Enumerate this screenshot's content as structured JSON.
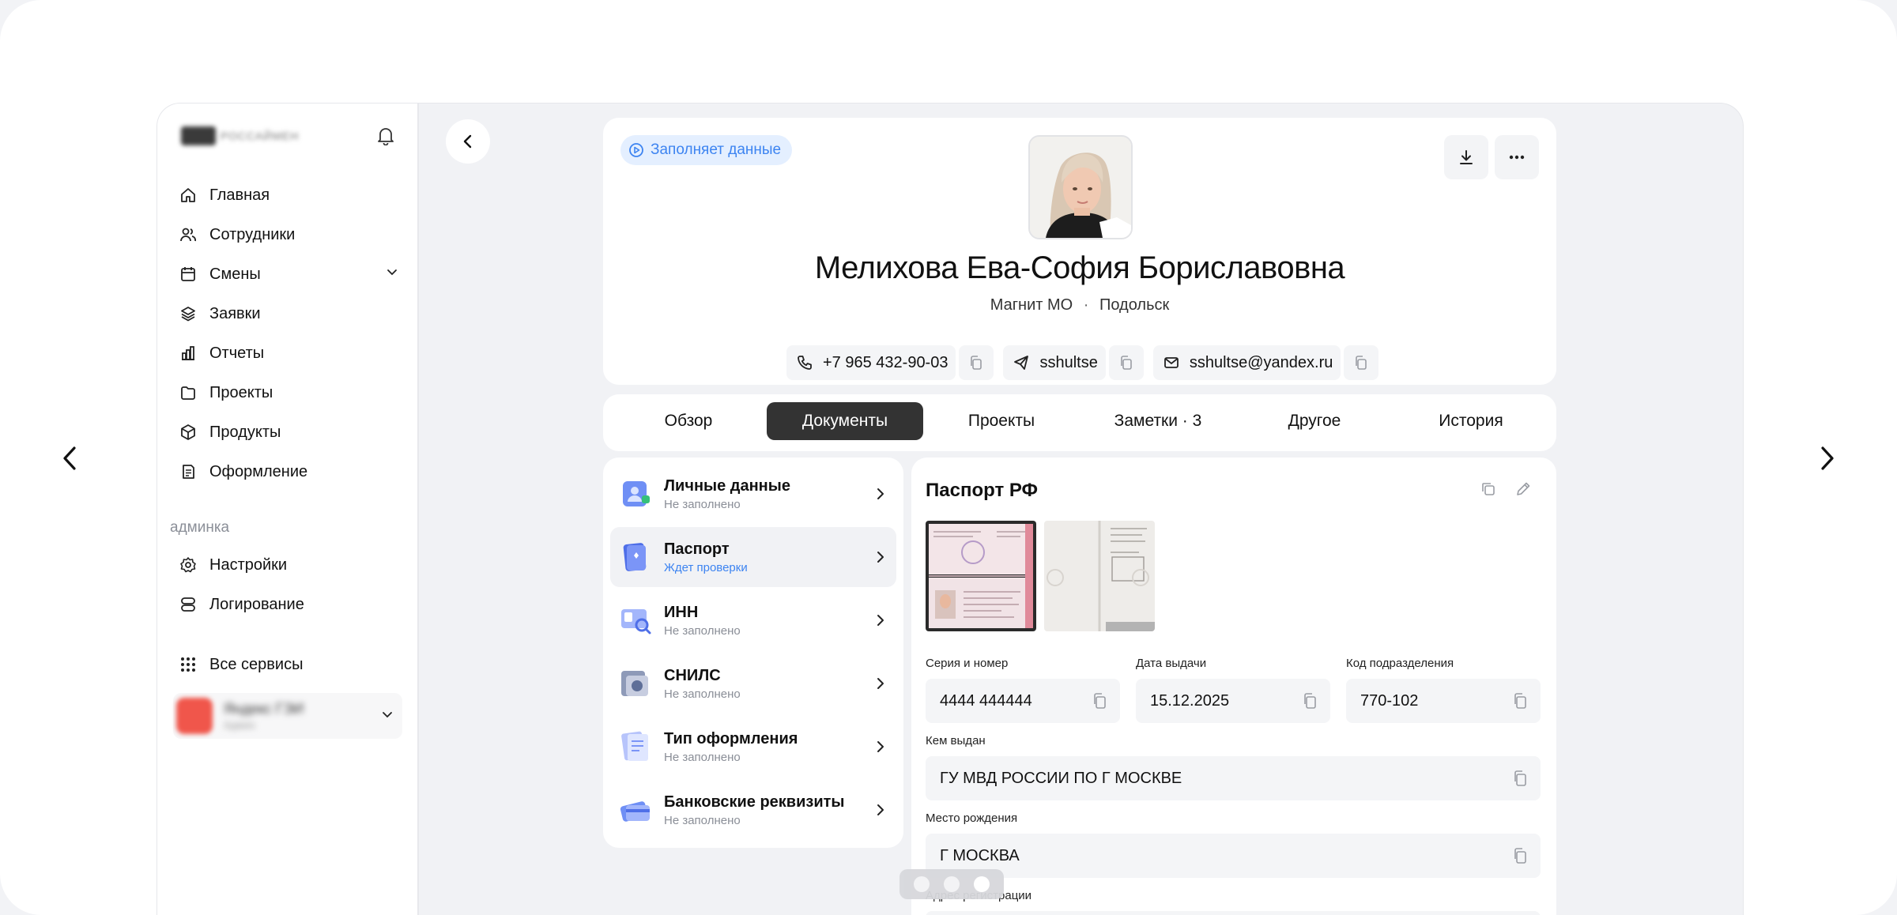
{
  "sidebar": {
    "brand": "РОССАЙМЕН",
    "menu": [
      {
        "label": "Главная",
        "icon": "home-icon"
      },
      {
        "label": "Сотрудники",
        "icon": "users-icon"
      },
      {
        "label": "Смены",
        "icon": "calendar-icon"
      },
      {
        "label": "Заявки",
        "icon": "layers-icon"
      },
      {
        "label": "Отчеты",
        "icon": "bar-chart-icon"
      },
      {
        "label": "Проекты",
        "icon": "folder-icon"
      },
      {
        "label": "Продукты",
        "icon": "box-icon"
      },
      {
        "label": "Оформление",
        "icon": "document-icon"
      }
    ],
    "admin_label": "админка",
    "admin_menu": [
      {
        "label": "Настройки",
        "icon": "gear-icon"
      },
      {
        "label": "Логирование",
        "icon": "database-icon"
      }
    ],
    "all_services": "Все сервисы",
    "account": {
      "name": "Яндекс ГЭИ",
      "sub": "Админ"
    }
  },
  "profile": {
    "status": "Заполняет данные",
    "name": "Мелихова Ева-София Бориславовна",
    "company": "Магнит МО",
    "separator": "·",
    "city": "Подольск",
    "phone": "+7 965 432-90-03",
    "telegram": "sshultse",
    "email": "sshultse@yandex.ru"
  },
  "tabs": [
    "Обзор",
    "Документы",
    "Проекты",
    "Заметки · 3",
    "Другое",
    "История"
  ],
  "active_tab": "Документы",
  "documents": [
    {
      "title": "Личные данные",
      "status": "Не заполнено"
    },
    {
      "title": "Паспорт",
      "status": "Ждет проверки"
    },
    {
      "title": "ИНН",
      "status": "Не заполнено"
    },
    {
      "title": "СНИЛС",
      "status": "Не заполнено"
    },
    {
      "title": "Тип оформления",
      "status": "Не заполнено"
    },
    {
      "title": "Банковские реквизиты",
      "status": "Не заполнено"
    }
  ],
  "passport": {
    "title": "Паспорт РФ",
    "series_label": "Серия и номер",
    "series_value": "4444 444444",
    "date_label": "Дата выдачи",
    "date_value": "15.12.2025",
    "code_label": "Код подразделения",
    "code_value": "770-102",
    "issued_label": "Кем выдан",
    "issued_value": "ГУ МВД РОССИИ ПО Г МОСКВЕ",
    "birth_label": "Место рождения",
    "birth_value": "Г МОСКВА",
    "reg_label": "Адрес регистрации"
  },
  "colors": {
    "accent": "#3d84f1",
    "active_tab": "#333333",
    "page_bg": "#f1f2f5"
  }
}
